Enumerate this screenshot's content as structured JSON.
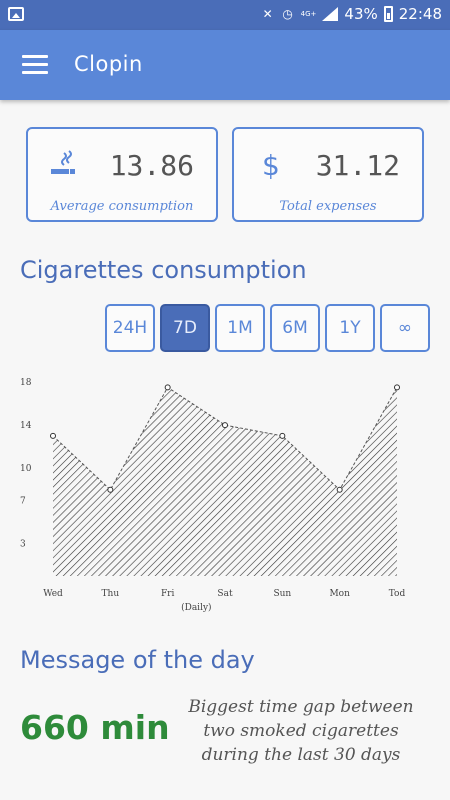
{
  "status_bar": {
    "battery": "43%",
    "time": "22:48",
    "network": "4G+",
    "icons": [
      "image-icon",
      "mute-icon",
      "alarm-icon",
      "signal-icon",
      "battery-icon"
    ]
  },
  "app_bar": {
    "title": "Clopin",
    "menu_icon": "hamburger-icon"
  },
  "stats": {
    "average": {
      "value": "13.86",
      "label": "Average consumption",
      "icon": "cigarette-icon"
    },
    "expenses": {
      "value": "31.12",
      "label": "Total expenses",
      "icon": "dollar-icon",
      "symbol": "$"
    }
  },
  "consumption": {
    "title": "Cigarettes consumption",
    "ranges": [
      {
        "label": "24H",
        "active": false
      },
      {
        "label": "7D",
        "active": true
      },
      {
        "label": "1M",
        "active": false
      },
      {
        "label": "6M",
        "active": false
      },
      {
        "label": "1Y",
        "active": false
      },
      {
        "label": "∞",
        "active": false
      }
    ]
  },
  "chart_data": {
    "type": "area",
    "categories": [
      "Wed",
      "Thu",
      "Fri",
      "Sat",
      "Sun",
      "Mon",
      "Tod"
    ],
    "values": [
      13,
      8,
      17.5,
      14,
      13,
      8,
      17.5
    ],
    "xlabel": "(Daily)",
    "ylabel": "",
    "yticks": [
      3,
      7,
      10,
      14,
      18
    ],
    "ylim": [
      0,
      18
    ],
    "fill": "hatched",
    "grid": false
  },
  "message": {
    "title": "Message of the day",
    "value": "660 min",
    "text": "Biggest time gap between two smoked cigarettes during the last 30 days"
  },
  "colors": {
    "primary": "#5a87d8",
    "status": "#4a6db8",
    "accent_green": "#2e8b3a"
  }
}
